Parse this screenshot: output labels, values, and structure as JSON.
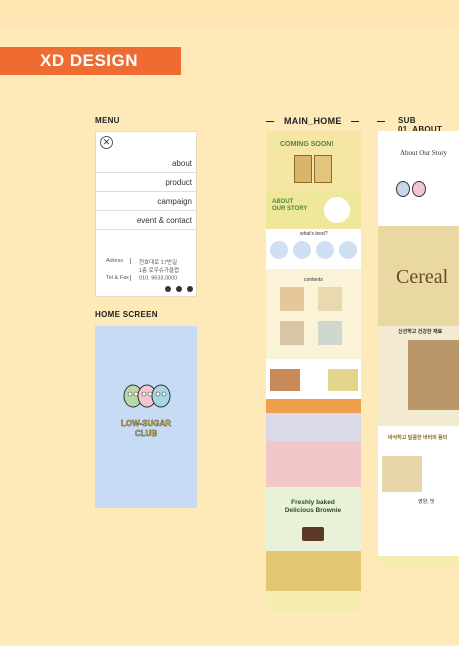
{
  "header": {
    "title": "XD DESIGN"
  },
  "sections": {
    "menu": "MENU",
    "home_screen": "HOME SCREEN",
    "main_home": "MAIN_HOME",
    "sub_about": "SUB 01_ABOUT"
  },
  "menu": {
    "items": [
      "about",
      "product",
      "campaign",
      "event & contact"
    ],
    "adress_label": "Adress",
    "adress_value": "천호대로 17번길 1층 로우슈가클럽",
    "tel_label": "Tel & Fax",
    "tel_value": "010. 9633.0000"
  },
  "home_screen": {
    "logo_text": "LOW-SUGAR CLUB"
  },
  "main_home": {
    "coming_soon": "COMING SOON!",
    "about_story": "ABOUT OUR STORY",
    "whats_best": "what's best?",
    "contents": "contents",
    "baked_title": "Freshly baked Delicious Brownie"
  },
  "sub_about": {
    "title": "About Our Story",
    "cereal": "Cereal",
    "korean_head": "신선하고 건강한 재료",
    "korean_mid": "바삭하고 달콤한 버터의 풍미",
    "korean_bottom": "영양, 맛"
  },
  "colors": {
    "accent": "#ee6b32",
    "background": "#fdeab8",
    "home_bg": "#c7dcf4"
  }
}
